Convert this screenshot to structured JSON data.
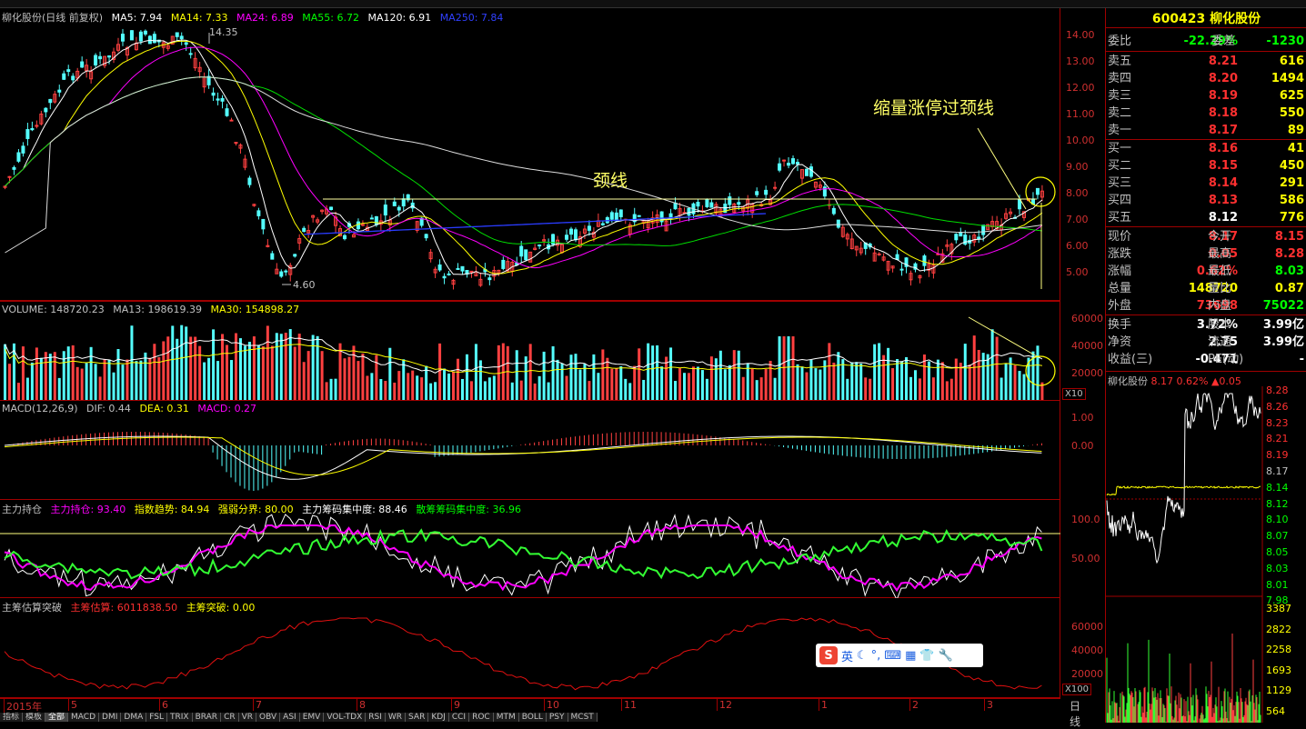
{
  "main": {
    "title": "柳化股份(日线 前复权)",
    "ma": [
      {
        "label": "MA5: 7.94",
        "color": "#ffffff"
      },
      {
        "label": "MA14: 7.33",
        "color": "#ffff00"
      },
      {
        "label": "MA24: 6.89",
        "color": "#ff00ff"
      },
      {
        "label": "MA55: 6.72",
        "color": "#00ff00"
      },
      {
        "label": "MA120: 6.91",
        "color": "#ffffff"
      },
      {
        "label": "MA250: 7.84",
        "color": "#3040ff"
      }
    ],
    "price_axis": [
      "14.00",
      "13.00",
      "12.00",
      "11.00",
      "10.00",
      "9.00",
      "8.00",
      "7.00",
      "6.00",
      "5.00"
    ],
    "high_mark": "14.35",
    "low_mark": "4.60",
    "annotation_neckline": "颈线",
    "annotation_breakout": "缩量涨停过颈线"
  },
  "volume": {
    "header": "VOLUME: 148720.23",
    "ma13": "MA13: 198619.39",
    "ma30": "MA30: 154898.27",
    "axis": [
      "60000",
      "40000",
      "20000"
    ],
    "unit": "X10"
  },
  "macd": {
    "header": "MACD(12,26,9)",
    "dif": "DIF: 0.44",
    "dea": "DEA: 0.31",
    "macd": "MACD: 0.27",
    "axis": [
      "1.00",
      "0.00"
    ]
  },
  "zlcc": {
    "header": "主力持仓",
    "v1": "主力持仓: 93.40",
    "v2": "指数趋势: 84.94",
    "v3": "强弱分界: 80.00",
    "v4": "主力筹码集中度: 88.46",
    "v5": "散筹筹码集中度: 36.96",
    "axis": [
      "100.0",
      "50.00"
    ]
  },
  "zcgs": {
    "header": "主筹估算突破",
    "v1": "主筹估算: 6011838.50",
    "v2": "主筹突破: 0.00",
    "axis": [
      "60000",
      "40000",
      "20000"
    ],
    "unit": "X100"
  },
  "dates": [
    "2015年",
    "5",
    "6",
    "7",
    "8",
    "9",
    "10",
    "11",
    "12",
    "1",
    "2",
    "3"
  ],
  "period": "日线",
  "tabs": [
    "指标",
    "模板",
    "全部",
    "MACD",
    "DMI",
    "DMA",
    "FSL",
    "TRIX",
    "BRAR",
    "CR",
    "VR",
    "OBV",
    "ASI",
    "EMV",
    "VOL-TDX",
    "RSI",
    "WR",
    "SAR",
    "KDJ",
    "CCI",
    "ROC",
    "MTM",
    "BOLL",
    "PSY",
    "MCST"
  ],
  "quote": {
    "code": "600423",
    "name": "柳化股份",
    "weibi_label": "委比",
    "weibi": "-22.29%",
    "weicha_label": "委差",
    "weicha": "-1230",
    "sells": [
      {
        "label": "卖五",
        "price": "8.21",
        "vol": "616"
      },
      {
        "label": "卖四",
        "price": "8.20",
        "vol": "1494"
      },
      {
        "label": "卖三",
        "price": "8.19",
        "vol": "625"
      },
      {
        "label": "卖二",
        "price": "8.18",
        "vol": "550"
      },
      {
        "label": "卖一",
        "price": "8.17",
        "vol": "89"
      }
    ],
    "buys": [
      {
        "label": "买一",
        "price": "8.16",
        "vol": "41"
      },
      {
        "label": "买二",
        "price": "8.15",
        "vol": "450"
      },
      {
        "label": "买三",
        "price": "8.14",
        "vol": "291"
      },
      {
        "label": "买四",
        "price": "8.13",
        "vol": "586"
      },
      {
        "label": "买五",
        "price": "8.12",
        "vol": "776"
      }
    ],
    "stats": [
      {
        "l1": "现价",
        "v1": "8.17",
        "l2": "今开",
        "v2": "8.15"
      },
      {
        "l1": "涨跌",
        "v1": "0.05",
        "l2": "最高",
        "v2": "8.28"
      },
      {
        "l1": "涨幅",
        "v1": "0.62%",
        "l2": "最低",
        "v2": "8.03"
      },
      {
        "l1": "总量",
        "v1": "148720",
        "l2": "量比",
        "v2": "0.87"
      },
      {
        "l1": "外盘",
        "v1": "73698",
        "l2": "内盘",
        "v2": "75022"
      }
    ],
    "stats2": [
      {
        "l1": "换手",
        "v1": "3.72%",
        "l2": "股本",
        "v2": "3.99亿"
      },
      {
        "l1": "净资",
        "v1": "2.75",
        "l2": "流通",
        "v2": "3.99亿"
      },
      {
        "l1": "收益(三)",
        "v1": "-0.471",
        "l2": "PE(动)",
        "v2": "-"
      }
    ]
  },
  "intraday": {
    "name": "柳化股份",
    "price": "8.17",
    "pct": "0.62%",
    "chg": "▲0.05",
    "axis": [
      "8.28",
      "8.26",
      "8.23",
      "8.21",
      "8.19",
      "8.17",
      "8.14",
      "8.12",
      "8.10",
      "8.07",
      "8.05",
      "8.03",
      "8.01",
      "7.98"
    ],
    "vol_axis": [
      "3387",
      "2822",
      "2258",
      "1693",
      "1129",
      "564"
    ]
  },
  "ime": {
    "brand": "S",
    "lang": "英"
  }
}
